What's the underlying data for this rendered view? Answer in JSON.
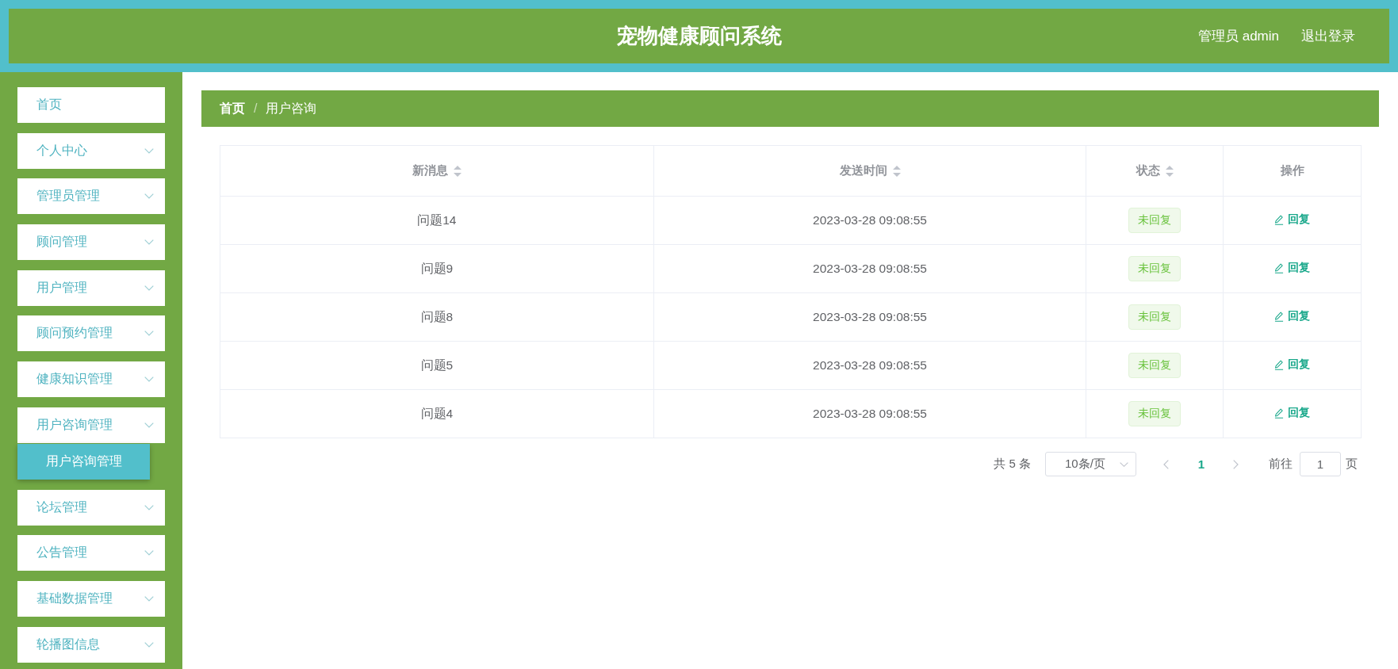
{
  "header": {
    "title": "宠物健康顾问系统",
    "user": "管理员 admin",
    "logout": "退出登录"
  },
  "sidebar": {
    "items": [
      {
        "label": "首页",
        "kind": "link",
        "selected": false
      },
      {
        "label": "个人中心",
        "kind": "submenu",
        "selected": false
      },
      {
        "label": "管理员管理",
        "kind": "submenu",
        "selected": false
      },
      {
        "label": "顾问管理",
        "kind": "submenu",
        "selected": false
      },
      {
        "label": "用户管理",
        "kind": "submenu",
        "selected": false
      },
      {
        "label": "顾问预约管理",
        "kind": "submenu",
        "selected": false
      },
      {
        "label": "健康知识管理",
        "kind": "submenu",
        "selected": false
      },
      {
        "label": "用户咨询管理",
        "kind": "submenu",
        "selected": false,
        "children": [
          {
            "label": "用户咨询管理",
            "selected": true
          }
        ]
      },
      {
        "label": "论坛管理",
        "kind": "submenu",
        "selected": false
      },
      {
        "label": "公告管理",
        "kind": "submenu",
        "selected": false
      },
      {
        "label": "基础数据管理",
        "kind": "submenu",
        "selected": false
      },
      {
        "label": "轮播图信息",
        "kind": "submenu",
        "selected": false
      }
    ]
  },
  "breadcrumb": {
    "items": [
      "首页",
      "用户咨询"
    ],
    "separator": "/"
  },
  "table": {
    "columns": [
      {
        "label": "新消息",
        "sortable": true
      },
      {
        "label": "发送时间",
        "sortable": true
      },
      {
        "label": "状态",
        "sortable": true
      },
      {
        "label": "操作",
        "sortable": false
      }
    ],
    "rows": [
      {
        "message": "问题14",
        "time": "2023-03-28 09:08:55",
        "status": "未回复",
        "action": "回复"
      },
      {
        "message": "问题9",
        "time": "2023-03-28 09:08:55",
        "status": "未回复",
        "action": "回复"
      },
      {
        "message": "问题8",
        "time": "2023-03-28 09:08:55",
        "status": "未回复",
        "action": "回复"
      },
      {
        "message": "问题5",
        "time": "2023-03-28 09:08:55",
        "status": "未回复",
        "action": "回复"
      },
      {
        "message": "问题4",
        "time": "2023-03-28 09:08:55",
        "status": "未回复",
        "action": "回复"
      }
    ]
  },
  "pagination": {
    "total": "共 5 条",
    "page_size": "10条/页",
    "pages": [
      {
        "label": "1",
        "selected": true
      }
    ],
    "goto_label": "前往",
    "goto_value": "1",
    "goto_suffix": "页"
  }
}
